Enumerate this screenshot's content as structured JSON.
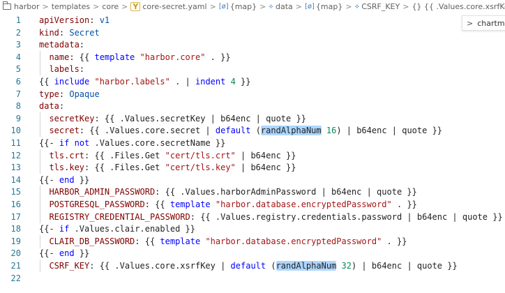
{
  "breadcrumb": {
    "items": [
      {
        "label": "harbor",
        "icon": "folder-icon"
      },
      {
        "label": "templates",
        "icon": ""
      },
      {
        "label": "core",
        "icon": ""
      },
      {
        "label": "core-secret.yaml",
        "icon": "yaml-icon"
      },
      {
        "label": "{map}",
        "icon": "map-icon"
      },
      {
        "label": "data",
        "icon": "key-icon"
      },
      {
        "label": "{map}",
        "icon": "map-icon"
      },
      {
        "label": "CSRF_KEY",
        "icon": "key-icon"
      },
      {
        "label": "{} {{ .Values.core.xsrfKey",
        "icon": ""
      }
    ],
    "separator": ">",
    "yaml_icon_glyph": "Y",
    "map_icon_glyph": "[ø]",
    "key_icon_glyph": "⟡"
  },
  "peek": {
    "label": "chartmus",
    "chevron": ">"
  },
  "lines": [
    {
      "n": "1",
      "text": "apiVersion: v1"
    },
    {
      "n": "2",
      "text": "kind: Secret"
    },
    {
      "n": "3",
      "text": "metadata:"
    },
    {
      "n": "4",
      "text": "  name: {{ template \"harbor.core\" . }}"
    },
    {
      "n": "5",
      "text": "  labels:"
    },
    {
      "n": "6",
      "text": "{{ include \"harbor.labels\" . | indent 4 }}"
    },
    {
      "n": "7",
      "text": "type: Opaque"
    },
    {
      "n": "8",
      "text": "data:"
    },
    {
      "n": "9",
      "text": "  secretKey: {{ .Values.secretKey | b64enc | quote }}"
    },
    {
      "n": "10",
      "text": "  secret: {{ .Values.core.secret | default (randAlphaNum 16) | b64enc | quote }}"
    },
    {
      "n": "11",
      "text": "{{- if not .Values.core.secretName }}"
    },
    {
      "n": "12",
      "text": "  tls.crt: {{ .Files.Get \"cert/tls.crt\" | b64enc }}"
    },
    {
      "n": "13",
      "text": "  tls.key: {{ .Files.Get \"cert/tls.key\" | b64enc }}"
    },
    {
      "n": "14",
      "text": "{{- end }}"
    },
    {
      "n": "15",
      "text": "  HARBOR_ADMIN_PASSWORD: {{ .Values.harborAdminPassword | b64enc | quote }}"
    },
    {
      "n": "16",
      "text": "  POSTGRESQL_PASSWORD: {{ template \"harbor.database.encryptedPassword\" . }}"
    },
    {
      "n": "17",
      "text": "  REGISTRY_CREDENTIAL_PASSWORD: {{ .Values.registry.credentials.password | b64enc | quote }}"
    },
    {
      "n": "18",
      "text": "{{- if .Values.clair.enabled }}"
    },
    {
      "n": "19",
      "text": "  CLAIR_DB_PASSWORD: {{ template \"harbor.database.encryptedPassword\" . }}"
    },
    {
      "n": "20",
      "text": "{{- end }}"
    },
    {
      "n": "21",
      "text": "  CSRF_KEY: {{ .Values.core.xsrfKey | default (randAlphaNum 32) | b64enc | quote }}"
    },
    {
      "n": "22",
      "text": ""
    }
  ],
  "highlight_word": "randAlphaNum",
  "colors": {
    "key": "#800000",
    "value": "#0451a5",
    "string": "#a31515",
    "keyword": "#0000ff",
    "number": "#098658",
    "line_number": "#237893",
    "highlight": "#add6ff"
  }
}
